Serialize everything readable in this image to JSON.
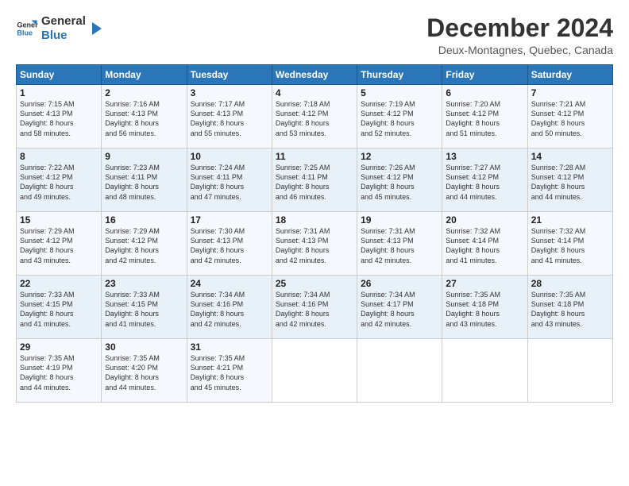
{
  "header": {
    "logo_line1": "General",
    "logo_line2": "Blue",
    "title": "December 2024",
    "location": "Deux-Montagnes, Quebec, Canada"
  },
  "days_of_week": [
    "Sunday",
    "Monday",
    "Tuesday",
    "Wednesday",
    "Thursday",
    "Friday",
    "Saturday"
  ],
  "weeks": [
    [
      {
        "day": "1",
        "text": "Sunrise: 7:15 AM\nSunset: 4:13 PM\nDaylight: 8 hours\nand 58 minutes."
      },
      {
        "day": "2",
        "text": "Sunrise: 7:16 AM\nSunset: 4:13 PM\nDaylight: 8 hours\nand 56 minutes."
      },
      {
        "day": "3",
        "text": "Sunrise: 7:17 AM\nSunset: 4:13 PM\nDaylight: 8 hours\nand 55 minutes."
      },
      {
        "day": "4",
        "text": "Sunrise: 7:18 AM\nSunset: 4:12 PM\nDaylight: 8 hours\nand 53 minutes."
      },
      {
        "day": "5",
        "text": "Sunrise: 7:19 AM\nSunset: 4:12 PM\nDaylight: 8 hours\nand 52 minutes."
      },
      {
        "day": "6",
        "text": "Sunrise: 7:20 AM\nSunset: 4:12 PM\nDaylight: 8 hours\nand 51 minutes."
      },
      {
        "day": "7",
        "text": "Sunrise: 7:21 AM\nSunset: 4:12 PM\nDaylight: 8 hours\nand 50 minutes."
      }
    ],
    [
      {
        "day": "8",
        "text": "Sunrise: 7:22 AM\nSunset: 4:12 PM\nDaylight: 8 hours\nand 49 minutes."
      },
      {
        "day": "9",
        "text": "Sunrise: 7:23 AM\nSunset: 4:11 PM\nDaylight: 8 hours\nand 48 minutes."
      },
      {
        "day": "10",
        "text": "Sunrise: 7:24 AM\nSunset: 4:11 PM\nDaylight: 8 hours\nand 47 minutes."
      },
      {
        "day": "11",
        "text": "Sunrise: 7:25 AM\nSunset: 4:11 PM\nDaylight: 8 hours\nand 46 minutes."
      },
      {
        "day": "12",
        "text": "Sunrise: 7:26 AM\nSunset: 4:12 PM\nDaylight: 8 hours\nand 45 minutes."
      },
      {
        "day": "13",
        "text": "Sunrise: 7:27 AM\nSunset: 4:12 PM\nDaylight: 8 hours\nand 44 minutes."
      },
      {
        "day": "14",
        "text": "Sunrise: 7:28 AM\nSunset: 4:12 PM\nDaylight: 8 hours\nand 44 minutes."
      }
    ],
    [
      {
        "day": "15",
        "text": "Sunrise: 7:29 AM\nSunset: 4:12 PM\nDaylight: 8 hours\nand 43 minutes."
      },
      {
        "day": "16",
        "text": "Sunrise: 7:29 AM\nSunset: 4:12 PM\nDaylight: 8 hours\nand 42 minutes."
      },
      {
        "day": "17",
        "text": "Sunrise: 7:30 AM\nSunset: 4:13 PM\nDaylight: 8 hours\nand 42 minutes."
      },
      {
        "day": "18",
        "text": "Sunrise: 7:31 AM\nSunset: 4:13 PM\nDaylight: 8 hours\nand 42 minutes."
      },
      {
        "day": "19",
        "text": "Sunrise: 7:31 AM\nSunset: 4:13 PM\nDaylight: 8 hours\nand 42 minutes."
      },
      {
        "day": "20",
        "text": "Sunrise: 7:32 AM\nSunset: 4:14 PM\nDaylight: 8 hours\nand 41 minutes."
      },
      {
        "day": "21",
        "text": "Sunrise: 7:32 AM\nSunset: 4:14 PM\nDaylight: 8 hours\nand 41 minutes."
      }
    ],
    [
      {
        "day": "22",
        "text": "Sunrise: 7:33 AM\nSunset: 4:15 PM\nDaylight: 8 hours\nand 41 minutes."
      },
      {
        "day": "23",
        "text": "Sunrise: 7:33 AM\nSunset: 4:15 PM\nDaylight: 8 hours\nand 41 minutes."
      },
      {
        "day": "24",
        "text": "Sunrise: 7:34 AM\nSunset: 4:16 PM\nDaylight: 8 hours\nand 42 minutes."
      },
      {
        "day": "25",
        "text": "Sunrise: 7:34 AM\nSunset: 4:16 PM\nDaylight: 8 hours\nand 42 minutes."
      },
      {
        "day": "26",
        "text": "Sunrise: 7:34 AM\nSunset: 4:17 PM\nDaylight: 8 hours\nand 42 minutes."
      },
      {
        "day": "27",
        "text": "Sunrise: 7:35 AM\nSunset: 4:18 PM\nDaylight: 8 hours\nand 43 minutes."
      },
      {
        "day": "28",
        "text": "Sunrise: 7:35 AM\nSunset: 4:18 PM\nDaylight: 8 hours\nand 43 minutes."
      }
    ],
    [
      {
        "day": "29",
        "text": "Sunrise: 7:35 AM\nSunset: 4:19 PM\nDaylight: 8 hours\nand 44 minutes."
      },
      {
        "day": "30",
        "text": "Sunrise: 7:35 AM\nSunset: 4:20 PM\nDaylight: 8 hours\nand 44 minutes."
      },
      {
        "day": "31",
        "text": "Sunrise: 7:35 AM\nSunset: 4:21 PM\nDaylight: 8 hours\nand 45 minutes."
      },
      null,
      null,
      null,
      null
    ]
  ]
}
